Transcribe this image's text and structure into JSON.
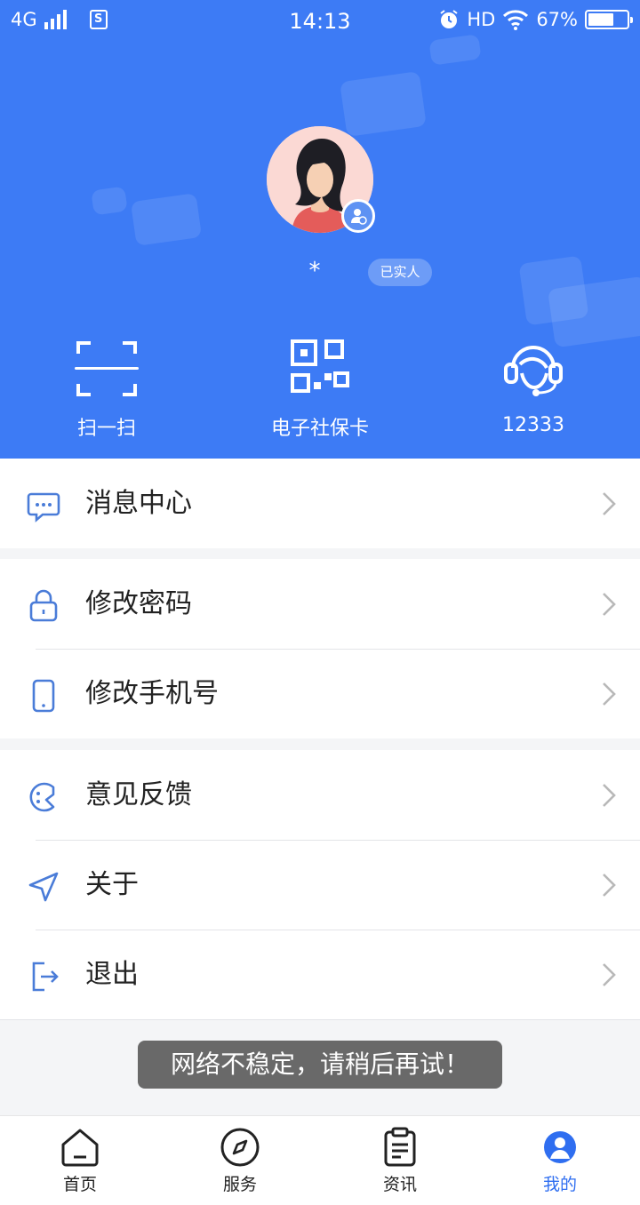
{
  "status_bar": {
    "network": "4G",
    "time": "14:13",
    "hd": "HD",
    "battery": "67%",
    "battery_level": 0.67
  },
  "profile": {
    "name": " *",
    "verified_badge": "已实人"
  },
  "quick_actions": [
    {
      "label": "扫一扫",
      "icon": "scan-icon"
    },
    {
      "label": "电子社保卡",
      "icon": "qr-code-icon"
    },
    {
      "label": "12333",
      "icon": "headset-icon"
    }
  ],
  "menu": {
    "messages": "消息中心",
    "change_password": "修改密码",
    "change_phone": "修改手机号",
    "feedback": "意见反馈",
    "about": "关于",
    "logout": "退出"
  },
  "toast": "网络不稳定，请稍后再试！",
  "tabbar": {
    "home": "首页",
    "services": "服务",
    "news": "资讯",
    "mine": "我的"
  },
  "colors": {
    "brand": "#3d7bf5",
    "icon": "#4a7cd8",
    "active_tab": "#2f6ef0"
  }
}
